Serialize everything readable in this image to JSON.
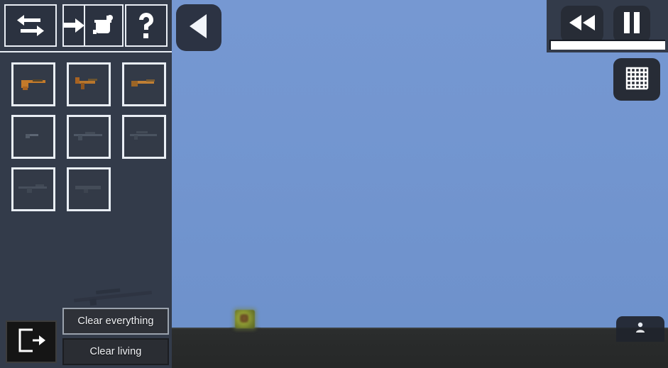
{
  "app": {
    "title": "Sandbox Game - Item Spawner"
  },
  "world": {
    "sky_color": "#7396d0",
    "ground_color": "#292b2b",
    "objects": [
      {
        "name": "crate",
        "label": "spawned-crate",
        "color": "#8d9a33"
      }
    ]
  },
  "toolbar": {
    "items": [
      {
        "name": "swap-icon",
        "label": "Swap / Transfer",
        "icon": "arrows-left-right"
      },
      {
        "name": "arrow-right-icon",
        "label": "Next",
        "icon": "arrow-right"
      },
      {
        "name": "paint-bucket-icon",
        "label": "Paint",
        "icon": "paint-bucket"
      },
      {
        "name": "help-icon",
        "label": "Help",
        "icon": "question-mark"
      }
    ]
  },
  "inventory": {
    "slots": [
      {
        "name": "slot-pistol-1",
        "label": "Pistol",
        "color": "#c47a2a",
        "kind": "pistol"
      },
      {
        "name": "slot-smg",
        "label": "SMG",
        "color": "#b9762c",
        "kind": "smg"
      },
      {
        "name": "slot-shotgun",
        "label": "Shotgun",
        "color": "#c07f34",
        "kind": "shotgun"
      },
      {
        "name": "slot-revolver",
        "label": "Revolver",
        "color": "#5d6674",
        "kind": "small"
      },
      {
        "name": "slot-rifle",
        "label": "Rifle",
        "color": "#4e5765",
        "kind": "rifle"
      },
      {
        "name": "slot-sniper",
        "label": "Sniper",
        "color": "#4a5360",
        "kind": "rifle"
      },
      {
        "name": "slot-lmg",
        "label": "LMG",
        "color": "#474f5c",
        "kind": "rifle"
      },
      {
        "name": "slot-launcher",
        "label": "Launcher",
        "color": "#444c58",
        "kind": "launcher"
      }
    ]
  },
  "context_menu": {
    "items": [
      {
        "name": "clear-everything",
        "label": "Clear everything",
        "selected": true
      },
      {
        "name": "clear-living",
        "label": "Clear living",
        "selected": false
      }
    ]
  },
  "exit": {
    "name": "exit-button",
    "label": "Exit",
    "icon": "exit-door-icon"
  },
  "back": {
    "name": "back-button",
    "label": "Back",
    "icon": "play-left-triangle-icon"
  },
  "transport": {
    "rewind": {
      "name": "rewind-button",
      "label": "Rewind",
      "icon": "rewind-icon"
    },
    "pause": {
      "name": "pause-button",
      "label": "Pause",
      "icon": "pause-icon"
    },
    "progress": {
      "name": "time-progress-bar",
      "value": 100,
      "fill_color": "#ffffff"
    }
  },
  "grid_toggle": {
    "name": "grid-toggle-button",
    "label": "Grid",
    "icon": "grid-mesh-icon"
  },
  "spawn": {
    "name": "spawn-character-button",
    "label": "Spawn",
    "icon": "person-icon"
  },
  "colors": {
    "sidebar": "#333b4a",
    "panel": "#2b3240",
    "outline": "#e9eef5",
    "menu_bg": "#2a2d33",
    "menu_selected_border": "#9aa2ad",
    "accent_weapon": "#c47a2a"
  }
}
